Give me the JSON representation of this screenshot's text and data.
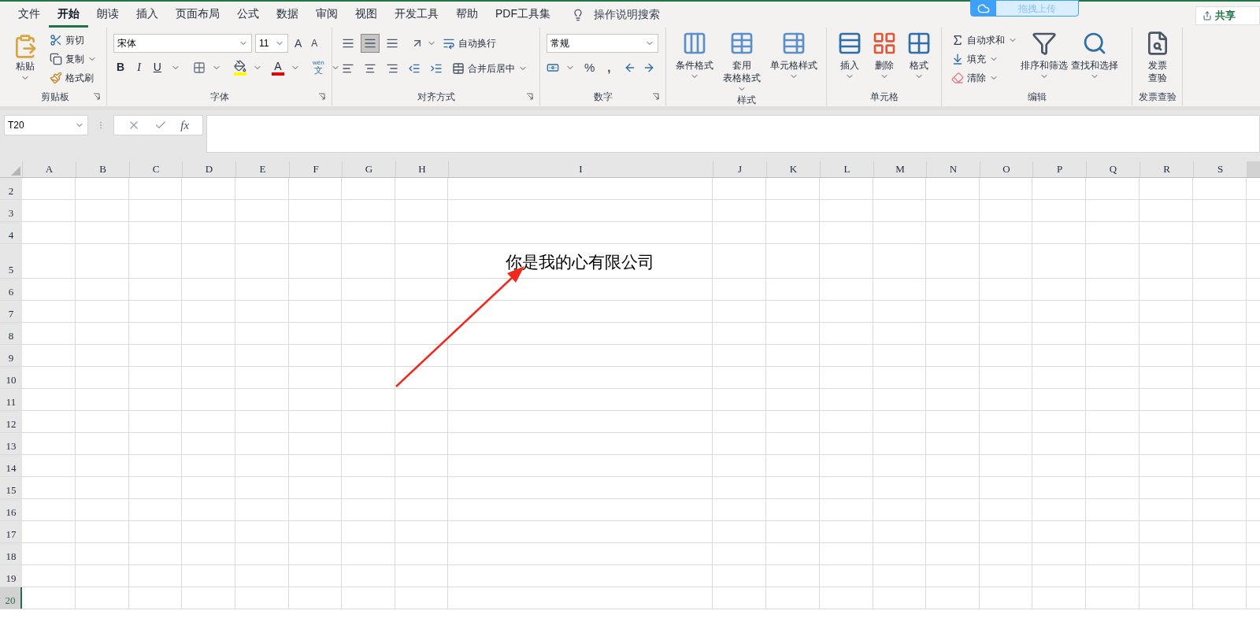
{
  "menu_tabs": [
    {
      "label": "文件",
      "selected": false
    },
    {
      "label": "开始",
      "selected": true
    },
    {
      "label": "朗读",
      "selected": false
    },
    {
      "label": "插入",
      "selected": false
    },
    {
      "label": "页面布局",
      "selected": false
    },
    {
      "label": "公式",
      "selected": false
    },
    {
      "label": "数据",
      "selected": false
    },
    {
      "label": "审阅",
      "selected": false
    },
    {
      "label": "视图",
      "selected": false
    },
    {
      "label": "开发工具",
      "selected": false
    },
    {
      "label": "帮助",
      "selected": false
    },
    {
      "label": "PDF工具集",
      "selected": false
    }
  ],
  "tell_me": "操作说明搜索",
  "upload_widget": {
    "label": "拖拽上传"
  },
  "share_button": {
    "label": "共享"
  },
  "ribbon": [
    {
      "kind": "clipboard",
      "label": "剪贴板",
      "paste": "粘贴",
      "commands": [
        "剪切",
        "复制",
        "格式刷"
      ]
    },
    {
      "kind": "font",
      "label": "字体",
      "font_name": "宋体",
      "font_size": "11",
      "grow_font": "A",
      "shrink_font": "A",
      "styles": [
        "B",
        "I",
        "U"
      ],
      "font_color": "A",
      "phonetic_guide": {
        "top": "wén",
        "bottom": "文"
      }
    },
    {
      "kind": "alignment",
      "label": "对齐方式",
      "vertical_align": [
        {
          "selected": false
        },
        {
          "selected": true
        },
        {
          "selected": false
        }
      ],
      "wrap_text": "自动换行",
      "merge_center": "合并后居中"
    },
    {
      "kind": "number",
      "label": "数字",
      "number_format": "常规",
      "percent": "%",
      "comma": ","
    },
    {
      "kind": "styles",
      "label": "样式",
      "commands": [
        {
          "lines": [
            "条件格式"
          ]
        },
        {
          "lines": [
            "套用",
            "表格格式"
          ]
        },
        {
          "lines": [
            "单元格样式"
          ]
        }
      ]
    },
    {
      "kind": "cells",
      "label": "单元格",
      "commands": [
        "插入",
        "删除",
        "格式"
      ]
    },
    {
      "kind": "editing",
      "label": "编辑",
      "commands": [
        "自动求和",
        "填充",
        "清除"
      ],
      "big_commands": [
        "排序和筛选",
        "查找和选择"
      ]
    },
    {
      "kind": "invoice",
      "label": "发票查验",
      "command": [
        "发票",
        "查验"
      ]
    }
  ],
  "formula_bar": {
    "name_box": "T20",
    "function_label": "fx"
  },
  "columns": [
    {
      "label": "A",
      "selected": false
    },
    {
      "label": "B",
      "selected": false
    },
    {
      "label": "C",
      "selected": false
    },
    {
      "label": "D",
      "selected": false
    },
    {
      "label": "E",
      "selected": false
    },
    {
      "label": "F",
      "selected": false
    },
    {
      "label": "G",
      "selected": false
    },
    {
      "label": "H",
      "selected": false
    },
    {
      "label": "I",
      "selected": false
    },
    {
      "label": "J",
      "selected": false
    },
    {
      "label": "K",
      "selected": false
    },
    {
      "label": "L",
      "selected": false
    },
    {
      "label": "M",
      "selected": false
    },
    {
      "label": "N",
      "selected": false
    },
    {
      "label": "O",
      "selected": false
    },
    {
      "label": "P",
      "selected": false
    },
    {
      "label": "Q",
      "selected": false
    },
    {
      "label": "R",
      "selected": false
    },
    {
      "label": "S",
      "selected": false
    }
  ],
  "rows": [
    {
      "label": "2",
      "selected": false
    },
    {
      "label": "3",
      "selected": false
    },
    {
      "label": "4",
      "selected": false
    },
    {
      "label": "5",
      "selected": false,
      "content": "你是我的心有限公司"
    },
    {
      "label": "6",
      "selected": false
    },
    {
      "label": "7",
      "selected": false
    },
    {
      "label": "8",
      "selected": false
    },
    {
      "label": "9",
      "selected": false
    },
    {
      "label": "10",
      "selected": false
    },
    {
      "label": "11",
      "selected": false
    },
    {
      "label": "12",
      "selected": false
    },
    {
      "label": "13",
      "selected": false
    },
    {
      "label": "14",
      "selected": false
    },
    {
      "label": "15",
      "selected": false
    },
    {
      "label": "16",
      "selected": false
    },
    {
      "label": "17",
      "selected": false
    },
    {
      "label": "18",
      "selected": false
    },
    {
      "label": "19",
      "selected": false
    },
    {
      "label": "20",
      "selected": true
    }
  ]
}
